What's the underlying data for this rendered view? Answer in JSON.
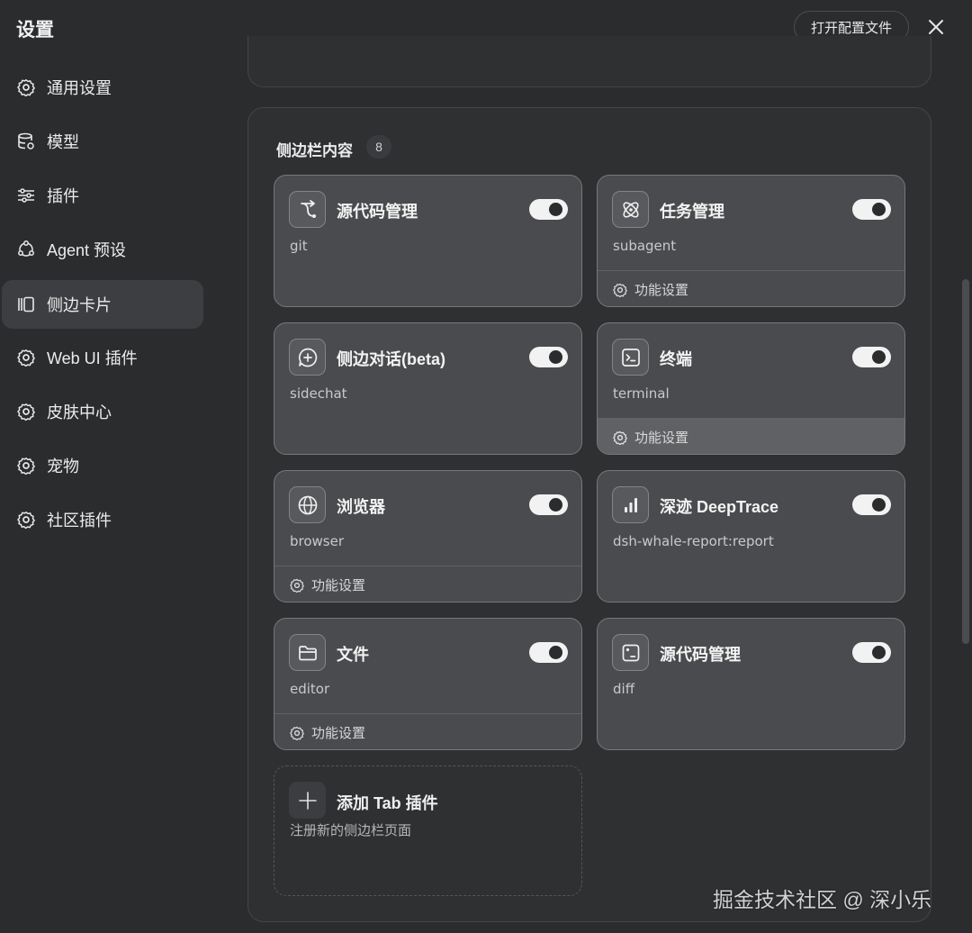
{
  "header": {
    "title": "设置",
    "open_config_label": "打开配置文件",
    "close_icon": "close-icon"
  },
  "sidebar": {
    "items": [
      {
        "label": "通用设置",
        "icon": "gear-icon"
      },
      {
        "label": "模型",
        "icon": "database-icon"
      },
      {
        "label": "插件",
        "icon": "sliders-icon"
      },
      {
        "label": "Agent 预设",
        "icon": "agent-nodes-icon"
      },
      {
        "label": "侧边卡片",
        "icon": "sidebar-panel-icon",
        "active": true
      },
      {
        "label": "Web UI 插件",
        "icon": "gear-icon"
      },
      {
        "label": "皮肤中心",
        "icon": "gear-icon"
      },
      {
        "label": "宠物",
        "icon": "gear-icon"
      },
      {
        "label": "社区插件",
        "icon": "gear-icon"
      }
    ]
  },
  "panel": {
    "title": "侧边栏内容",
    "count": "8",
    "footer_label": "功能设置",
    "cards": [
      {
        "title": "源代码管理",
        "subtitle": "git",
        "icon": "git-branch-icon",
        "enabled": true,
        "has_footer": false
      },
      {
        "title": "任务管理",
        "subtitle": "subagent",
        "icon": "atom-icon",
        "enabled": true,
        "has_footer": true
      },
      {
        "title": "侧边对话(beta)",
        "subtitle": "sidechat",
        "icon": "chat-plus-icon",
        "enabled": true,
        "has_footer": false
      },
      {
        "title": "终端",
        "subtitle": "terminal",
        "icon": "terminal-icon",
        "enabled": true,
        "has_footer": true
      },
      {
        "title": "浏览器",
        "subtitle": "browser",
        "icon": "globe-icon",
        "enabled": true,
        "has_footer": true
      },
      {
        "title": "深迹 DeepTrace",
        "subtitle": "dsh-whale-report:report",
        "icon": "bar-chart-icon",
        "enabled": true,
        "has_footer": false
      },
      {
        "title": "文件",
        "subtitle": "editor",
        "icon": "folder-icon",
        "enabled": true,
        "has_footer": true
      },
      {
        "title": "源代码管理",
        "subtitle": "diff",
        "icon": "diff-icon",
        "enabled": true,
        "has_footer": false
      }
    ],
    "add_card": {
      "title": "添加 Tab 插件",
      "subtitle": "注册新的侧边栏页面",
      "icon": "plus-icon"
    }
  },
  "watermark": "掘金技术社区 @ 深小乐",
  "colors": {
    "background": "#2b2c2e",
    "card": "#4a4b4e",
    "card_border": "#77787b",
    "toggle_on": "#f2f2f2",
    "active_nav": "#3d3e41"
  }
}
